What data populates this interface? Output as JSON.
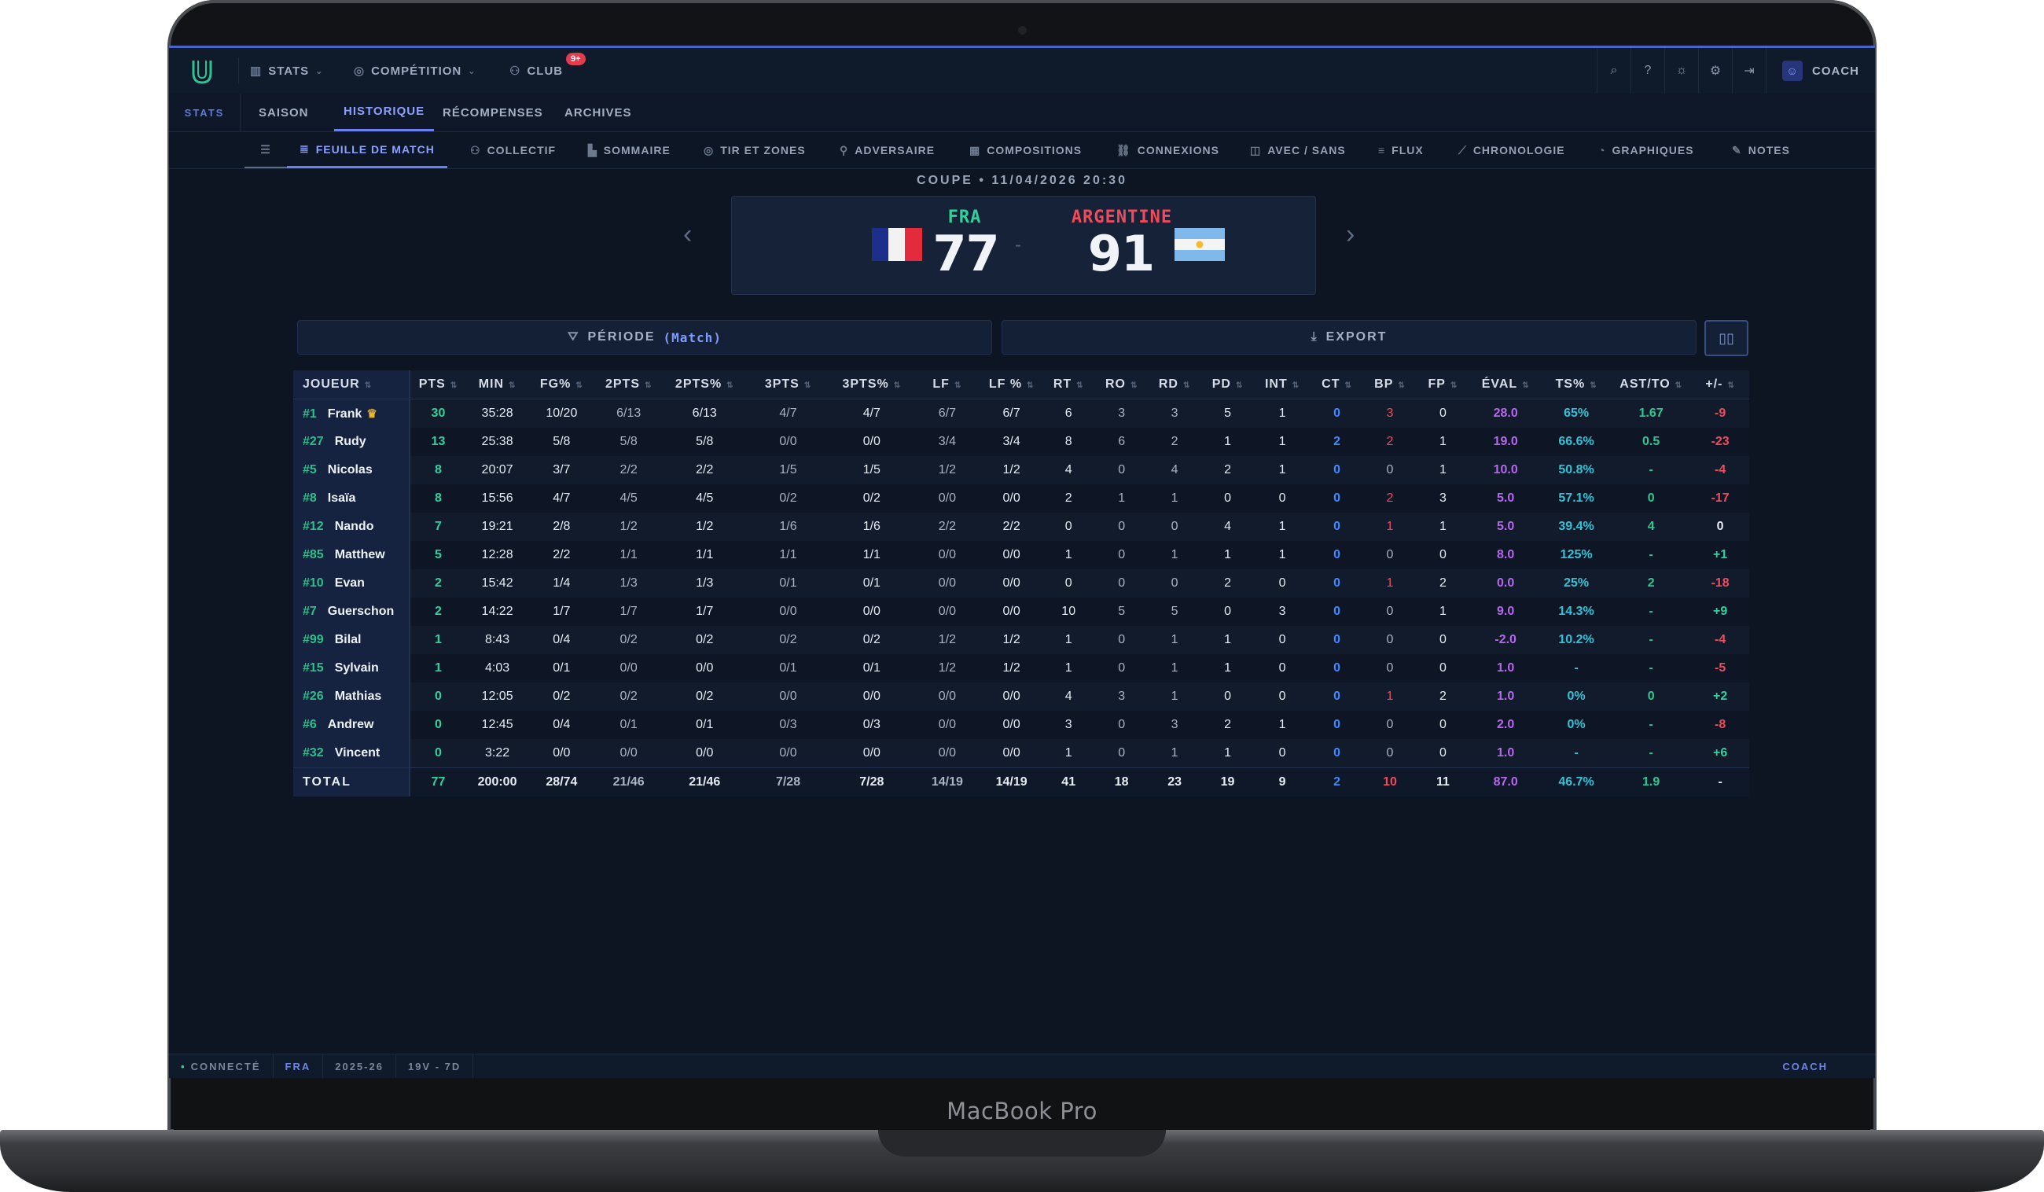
{
  "device": {
    "brand": "MacBook Pro"
  },
  "topnav": {
    "items": [
      {
        "label": "STATS",
        "icon": "bar-chart-icon"
      },
      {
        "label": "COMPÉTITION",
        "icon": "trophy-icon"
      },
      {
        "label": "CLUB",
        "icon": "people-icon",
        "badge": "9+"
      }
    ],
    "coach_label": "COACH"
  },
  "tabs": {
    "section_label": "STATS",
    "items": [
      "SAISON",
      "HISTORIQUE",
      "RÉCOMPENSES",
      "ARCHIVES"
    ],
    "active": "HISTORIQUE"
  },
  "subtabs": {
    "items": [
      "FEUILLE DE MATCH",
      "COLLECTIF",
      "SOMMAIRE",
      "TIR ET ZONES",
      "ADVERSAIRE",
      "COMPOSITIONS",
      "CONNEXIONS",
      "AVEC / SANS",
      "FLUX",
      "CHRONOLOGIE",
      "GRAPHIQUES",
      "NOTES"
    ],
    "active": "FEUILLE DE MATCH"
  },
  "game": {
    "label": "COUPE • 11/04/2026 20:30",
    "home": {
      "code": "FRA",
      "score": "77",
      "color": "#2fd39a"
    },
    "away": {
      "name": "ARGENTINE",
      "score": "91",
      "color": "#f04b5c"
    },
    "separator": "-"
  },
  "actions": {
    "period_label": "PÉRIODE",
    "period_value": "(Match)",
    "export_label": "EXPORT"
  },
  "table": {
    "columns": [
      "JOUEUR",
      "PTS",
      "MIN",
      "FG%",
      "2PTS",
      "2PTS%",
      "3PTS",
      "3PTS%",
      "LF",
      "LF %",
      "RT",
      "RO",
      "RD",
      "PD",
      "INT",
      "CT",
      "BP",
      "FP",
      "ÉVAL",
      "TS%",
      "AST/TO",
      "+/-"
    ],
    "rows": [
      {
        "num": "#1",
        "name": "Frank",
        "crown": true,
        "vals": [
          "30",
          "35:28",
          "10/20",
          "6/13",
          "6/13",
          "4/7",
          "4/7",
          "6/7",
          "6/7",
          "6",
          "3",
          "3",
          "5",
          "1",
          "0",
          "3",
          "0",
          "28.0",
          "65%",
          "1.67",
          "-9"
        ]
      },
      {
        "num": "#27",
        "name": "Rudy",
        "vals": [
          "13",
          "25:38",
          "5/8",
          "5/8",
          "5/8",
          "0/0",
          "0/0",
          "3/4",
          "3/4",
          "8",
          "6",
          "2",
          "1",
          "1",
          "2",
          "2",
          "1",
          "19.0",
          "66.6%",
          "0.5",
          "-23"
        ]
      },
      {
        "num": "#5",
        "name": "Nicolas",
        "vals": [
          "8",
          "20:07",
          "3/7",
          "2/2",
          "2/2",
          "1/5",
          "1/5",
          "1/2",
          "1/2",
          "4",
          "0",
          "4",
          "2",
          "1",
          "0",
          "0",
          "1",
          "10.0",
          "50.8%",
          "-",
          "-4"
        ]
      },
      {
        "num": "#8",
        "name": "Isaïa",
        "vals": [
          "8",
          "15:56",
          "4/7",
          "4/5",
          "4/5",
          "0/2",
          "0/2",
          "0/0",
          "0/0",
          "2",
          "1",
          "1",
          "0",
          "0",
          "0",
          "2",
          "3",
          "5.0",
          "57.1%",
          "0",
          "-17"
        ]
      },
      {
        "num": "#12",
        "name": "Nando",
        "vals": [
          "7",
          "19:21",
          "2/8",
          "1/2",
          "1/2",
          "1/6",
          "1/6",
          "2/2",
          "2/2",
          "0",
          "0",
          "0",
          "4",
          "1",
          "0",
          "1",
          "1",
          "5.0",
          "39.4%",
          "4",
          "0"
        ]
      },
      {
        "num": "#85",
        "name": "Matthew",
        "vals": [
          "5",
          "12:28",
          "2/2",
          "1/1",
          "1/1",
          "1/1",
          "1/1",
          "0/0",
          "0/0",
          "1",
          "0",
          "1",
          "1",
          "1",
          "0",
          "0",
          "0",
          "8.0",
          "125%",
          "-",
          "+1"
        ]
      },
      {
        "num": "#10",
        "name": "Evan",
        "vals": [
          "2",
          "15:42",
          "1/4",
          "1/3",
          "1/3",
          "0/1",
          "0/1",
          "0/0",
          "0/0",
          "0",
          "0",
          "0",
          "2",
          "0",
          "0",
          "1",
          "2",
          "0.0",
          "25%",
          "2",
          "-18"
        ]
      },
      {
        "num": "#7",
        "name": "Guerschon",
        "vals": [
          "2",
          "14:22",
          "1/7",
          "1/7",
          "1/7",
          "0/0",
          "0/0",
          "0/0",
          "0/0",
          "10",
          "5",
          "5",
          "0",
          "3",
          "0",
          "0",
          "1",
          "9.0",
          "14.3%",
          "-",
          "+9"
        ]
      },
      {
        "num": "#99",
        "name": "Bilal",
        "vals": [
          "1",
          "8:43",
          "0/4",
          "0/2",
          "0/2",
          "0/2",
          "0/2",
          "1/2",
          "1/2",
          "1",
          "0",
          "1",
          "1",
          "0",
          "0",
          "0",
          "0",
          "-2.0",
          "10.2%",
          "-",
          "-4"
        ]
      },
      {
        "num": "#15",
        "name": "Sylvain",
        "vals": [
          "1",
          "4:03",
          "0/1",
          "0/0",
          "0/0",
          "0/1",
          "0/1",
          "1/2",
          "1/2",
          "1",
          "0",
          "1",
          "1",
          "0",
          "0",
          "0",
          "0",
          "1.0",
          "-",
          "-",
          "-5"
        ]
      },
      {
        "num": "#26",
        "name": "Mathias",
        "vals": [
          "0",
          "12:05",
          "0/2",
          "0/2",
          "0/2",
          "0/0",
          "0/0",
          "0/0",
          "0/0",
          "4",
          "3",
          "1",
          "0",
          "0",
          "0",
          "1",
          "2",
          "1.0",
          "0%",
          "0",
          "+2"
        ]
      },
      {
        "num": "#6",
        "name": "Andrew",
        "vals": [
          "0",
          "12:45",
          "0/4",
          "0/1",
          "0/1",
          "0/3",
          "0/3",
          "0/0",
          "0/0",
          "3",
          "0",
          "3",
          "2",
          "1",
          "0",
          "0",
          "0",
          "2.0",
          "0%",
          "-",
          "-8"
        ]
      },
      {
        "num": "#32",
        "name": "Vincent",
        "vals": [
          "0",
          "3:22",
          "0/0",
          "0/0",
          "0/0",
          "0/0",
          "0/0",
          "0/0",
          "0/0",
          "1",
          "0",
          "1",
          "1",
          "0",
          "0",
          "0",
          "0",
          "1.0",
          "-",
          "-",
          "+6"
        ]
      }
    ],
    "total": {
      "label": "TOTAL",
      "vals": [
        "77",
        "200:00",
        "28/74",
        "21/46",
        "21/46",
        "7/28",
        "7/28",
        "14/19",
        "14/19",
        "41",
        "18",
        "23",
        "19",
        "9",
        "2",
        "10",
        "11",
        "87.0",
        "46.7%",
        "1.9",
        "-"
      ]
    }
  },
  "statusbar": {
    "connected": "CONNECTÉ",
    "team": "FRA",
    "season": "2025-26",
    "record": "19V - 7D",
    "role": "COACH"
  }
}
